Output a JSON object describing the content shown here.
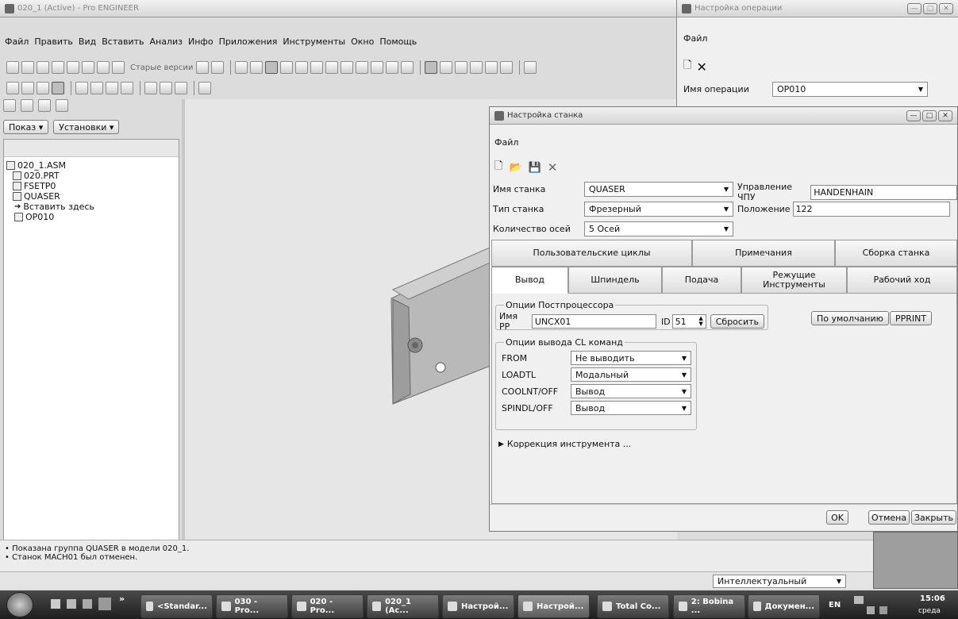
{
  "main_window": {
    "title": "020_1 (Active) - Pro ENGINEER",
    "menu": [
      "Файл",
      "Править",
      "Вид",
      "Вставить",
      "Анализ",
      "Инфо",
      "Приложения",
      "Инструменты",
      "Окно",
      "Помощь"
    ],
    "old_versions_label": "Старые версии"
  },
  "sidebar": {
    "show_button": "Показ ▾",
    "settings_button": "Установки ▾",
    "tree": [
      {
        "label": "020_1.ASM",
        "icon": "assembly-icon"
      },
      {
        "label": "020.PRT",
        "icon": "part-icon"
      },
      {
        "label": "FSETP0",
        "icon": "fixture-icon"
      },
      {
        "label": "QUASER",
        "icon": "machine-icon"
      },
      {
        "label": "Вставить здесь",
        "icon": "insert-arrow-icon"
      },
      {
        "label": "OP010",
        "icon": "operation-icon"
      }
    ]
  },
  "status": {
    "messages": [
      "• Показана группа QUASER в модели 020_1.",
      "• Станок MACH01 был отменен."
    ],
    "filter": "Интеллектуальный"
  },
  "op_window": {
    "title": "Настройка операции",
    "menu": "Файл",
    "op_name_label": "Имя операции",
    "op_name_value": "OP010"
  },
  "machine_dialog": {
    "title": "Настройка станка",
    "menu": "Файл",
    "name_label": "Имя станка",
    "name_value": "QUASER",
    "cnc_label": "Управление ЧПУ",
    "cnc_value": "HANDENHAIN",
    "type_label": "Тип станка",
    "type_value": "Фрезерный",
    "position_label": "Положение",
    "position_value": "122",
    "axes_label": "Количество осей",
    "axes_value": "5 Осей",
    "tabs_row1": [
      "Пользовательские циклы",
      "Примечания",
      "Сборка станка"
    ],
    "tabs_row2": [
      "Вывод",
      "Шпиндель",
      "Подача",
      "Режущие Инструменты",
      "Рабочий ход"
    ],
    "pp_group": "Опции Постпроцессора",
    "pp_name_label": "Имя PP",
    "pp_name_value": "UNCX01",
    "id_label": "ID",
    "id_value": "51",
    "reset_button": "Сбросить",
    "default_button": "По умолчанию",
    "pprint_button": "PPRINT",
    "cl_group": "Опции вывода CL команд",
    "cl_rows": [
      {
        "label": "FROM",
        "value": "Не выводить"
      },
      {
        "label": "LOADTL",
        "value": "Модальный"
      },
      {
        "label": "COOLNT/OFF",
        "value": "Вывод"
      },
      {
        "label": "SPINDL/OFF",
        "value": "Вывод"
      }
    ],
    "tool_correction": "Коррекция инструмента ...",
    "ok_button": "OK",
    "cancel_button": "Отмена",
    "close_button": "Закрыть"
  },
  "taskbar": {
    "items": [
      "<Standar...",
      "030 - Pro...",
      "020 - Pro...",
      "020_1 (Ac...",
      "Настрой...",
      "Настрой...",
      "Total Co...",
      "2: Bobina ...",
      "Докумен..."
    ],
    "lang": "EN",
    "time": "15:06",
    "day": "среда"
  }
}
